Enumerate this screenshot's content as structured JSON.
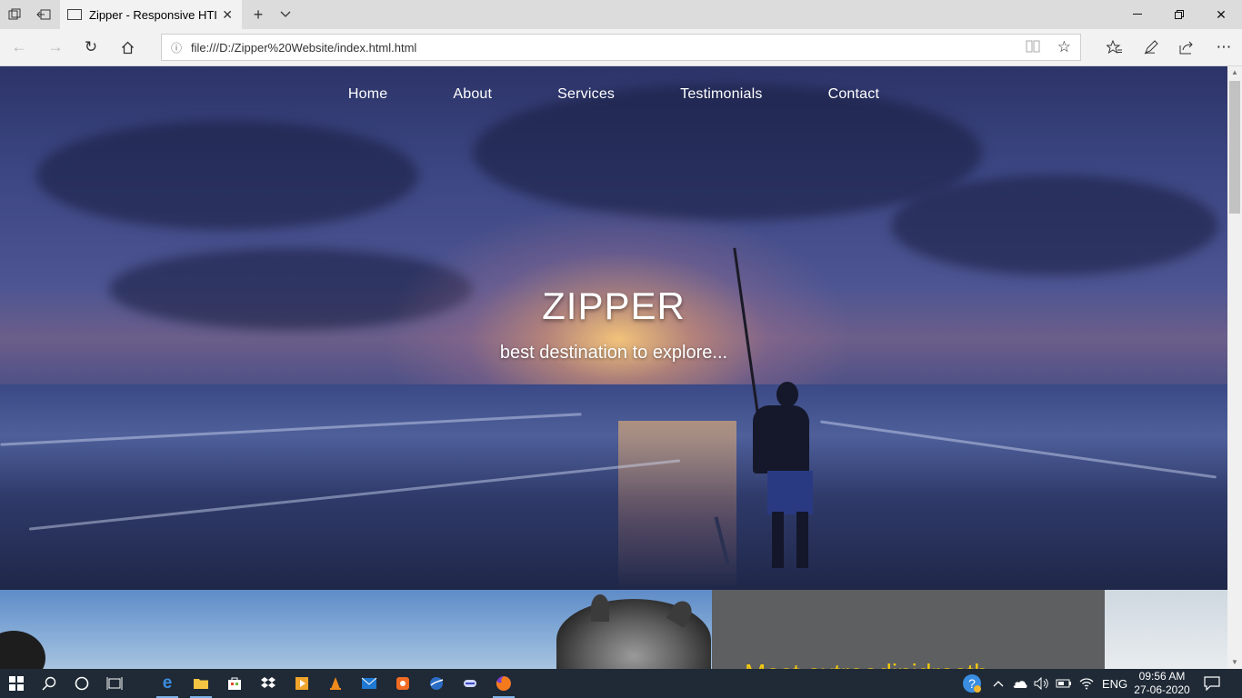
{
  "browser": {
    "tab_title": "Zipper - Responsive HTI",
    "url": "file:///D:/Zipper%20Website/index.html.html",
    "icons": {
      "set_aside_tabs": "set-aside-icon",
      "show_aside_tabs": "tabs-aside-icon",
      "tab_favicon": "page-icon",
      "tab_close": "close-icon",
      "new_tab": "plus-icon",
      "tab_list": "chevron-down-icon",
      "back": "arrow-left-icon",
      "forward": "arrow-right-icon",
      "refresh": "refresh-icon",
      "home": "home-icon",
      "site_info": "info-icon",
      "reading_view": "book-icon",
      "favorite": "star-icon",
      "favorites_hub": "favorites-icon",
      "annotate": "pen-icon",
      "share": "share-icon",
      "more": "more-icon"
    }
  },
  "page": {
    "nav": [
      "Home",
      "About",
      "Services",
      "Testimonials",
      "Contact"
    ],
    "hero_title": "ZIPPER",
    "hero_subtitle": "best destination to explore...",
    "section2_heading": "Most extraodinidrasth"
  },
  "taskbar": {
    "time": "09:56 AM",
    "date": "27-06-2020",
    "language": "ENG",
    "apps": [
      "start-icon",
      "search-icon",
      "cortana-icon",
      "task-view-icon",
      "edge-icon",
      "file-explorer-icon",
      "store-icon",
      "dropbox-icon",
      "media-player-icon",
      "vlc-icon",
      "mail-icon",
      "app-icon",
      "browser-icon",
      "toggle-icon",
      "firefox-icon"
    ],
    "tray_icons": [
      "help-icon",
      "chevron-up-icon",
      "onedrive-icon",
      "volume-icon",
      "battery-icon",
      "wifi-icon",
      "notification-icon"
    ]
  },
  "colors": {
    "accent_yellow": "#f2c90c",
    "taskbar_bg": "#1f2a36"
  }
}
